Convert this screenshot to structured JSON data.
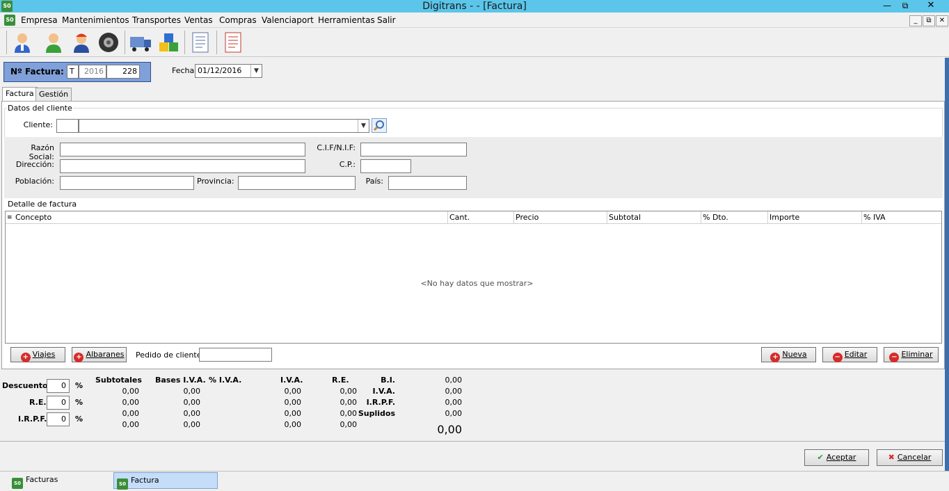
{
  "window": {
    "title": "Digitrans -                 - [Factura]",
    "app_icon": "S0"
  },
  "menu": {
    "items": [
      "Empresa",
      "Mantenimientos",
      "Transportes",
      "Ventas",
      "Compras",
      "Valenciaport",
      "Herramientas",
      "Salir"
    ]
  },
  "toolbar": {
    "icons": [
      "user-blue-icon",
      "user-green-icon",
      "driver-icon",
      "tire-icon",
      "truck-icon",
      "boxes-icon",
      "document-icon",
      "invoice-icon"
    ]
  },
  "header": {
    "nfactura_label": "Nº Factura:",
    "serie": "T",
    "year": "2016",
    "number": "228",
    "fecha_label": "Fecha:",
    "fecha_value": "01/12/2016"
  },
  "tabs": [
    "Factura",
    "Gestión"
  ],
  "cliente": {
    "group_label": "Datos del cliente",
    "cliente_label": "Cliente:",
    "razon_label": "Razón Social:",
    "cif_label": "C.I.F/N.I.F:",
    "direccion_label": "Dirección:",
    "cp_label": "C.P.:",
    "poblacion_label": "Población:",
    "provincia_label": "Provincia:",
    "pais_label": "País:"
  },
  "detalle": {
    "group_label": "Detalle de factura",
    "columns": [
      "Concepto",
      "Cant.",
      "Precio",
      "Subtotal",
      "% Dto.",
      "Importe",
      "% IVA"
    ],
    "empty_message": "<No hay datos que mostrar>"
  },
  "buttons": {
    "viajes": "Viajes",
    "albaranes": "Albaranes",
    "pedido_label": "Pedido de cliente:",
    "nueva": "Nueva",
    "editar": "Editar",
    "eliminar": "Eliminar",
    "aceptar": "Aceptar",
    "cancelar": "Cancelar"
  },
  "totals": {
    "descuento_label": "Descuento",
    "descuento_value": "0",
    "re_label": "R.E.",
    "re_value": "0",
    "irpf_label": "I.R.P.F.",
    "irpf_value": "0",
    "pct": "%",
    "headers": [
      "Subtotales",
      "Bases I.V.A.",
      "% I.V.A.",
      "I.V.A.",
      "R.E."
    ],
    "rows": [
      [
        "0,00",
        "0,00",
        "",
        "0,00",
        "0,00"
      ],
      [
        "0,00",
        "0,00",
        "",
        "0,00",
        "0,00"
      ],
      [
        "0,00",
        "0,00",
        "",
        "0,00",
        "0,00"
      ],
      [
        "0,00",
        "0,00",
        "",
        "0,00",
        "0,00"
      ]
    ],
    "summary_labels": [
      "B.I.",
      "I.V.A.",
      "I.R.P.F.",
      "Suplidos"
    ],
    "summary_values": [
      "0,00",
      "0,00",
      "0,00",
      "0,00"
    ],
    "grand_total": "0,00"
  },
  "taskbar": {
    "items": [
      "Facturas",
      "Factura"
    ]
  }
}
